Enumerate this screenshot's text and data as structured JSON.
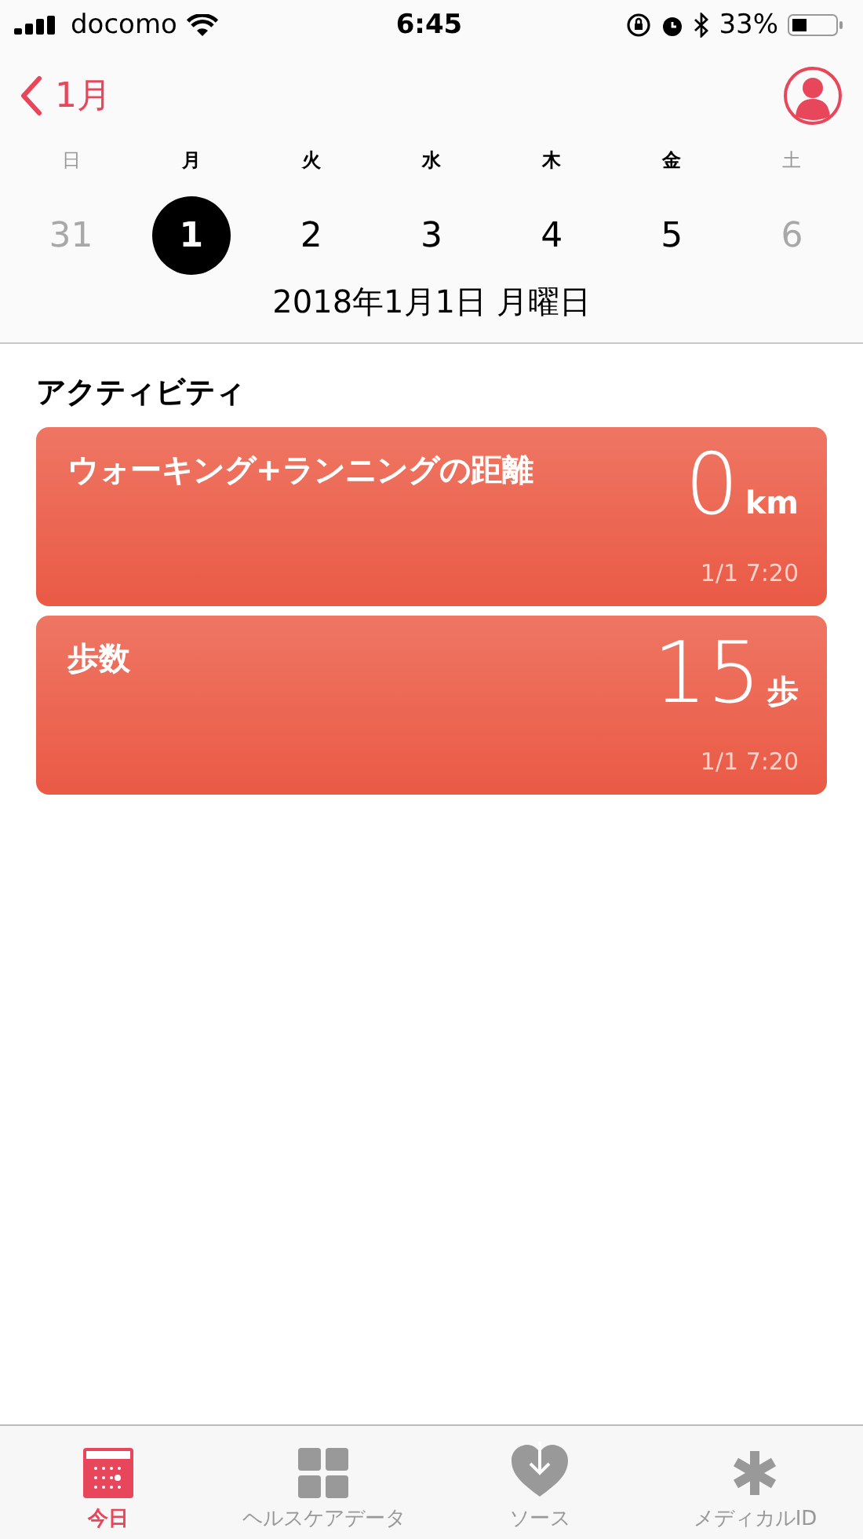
{
  "status_bar": {
    "carrier": "docomo",
    "time": "6:45",
    "battery": "33%"
  },
  "nav": {
    "back_label": "1月"
  },
  "weekdays": [
    {
      "label": "日",
      "dimmed": true
    },
    {
      "label": "月",
      "dimmed": false
    },
    {
      "label": "火",
      "dimmed": false
    },
    {
      "label": "水",
      "dimmed": false
    },
    {
      "label": "木",
      "dimmed": false
    },
    {
      "label": "金",
      "dimmed": false
    },
    {
      "label": "土",
      "dimmed": true
    }
  ],
  "days": [
    {
      "label": "31",
      "dimmed": true,
      "selected": false
    },
    {
      "label": "1",
      "dimmed": false,
      "selected": true
    },
    {
      "label": "2",
      "dimmed": false,
      "selected": false
    },
    {
      "label": "3",
      "dimmed": false,
      "selected": false
    },
    {
      "label": "4",
      "dimmed": false,
      "selected": false
    },
    {
      "label": "5",
      "dimmed": false,
      "selected": false
    },
    {
      "label": "6",
      "dimmed": true,
      "selected": false
    }
  ],
  "date_title": "2018年1月1日 月曜日",
  "section_title": "アクティビティ",
  "cards": [
    {
      "title": "ウォーキング+ランニングの距離",
      "value": "0",
      "unit": "km",
      "time": "1/1 7:20"
    },
    {
      "title": "歩数",
      "value": "15",
      "unit": "歩",
      "time": "1/1 7:20"
    }
  ],
  "tabs": [
    {
      "kind": "today",
      "label": "今日",
      "selected": true
    },
    {
      "kind": "data",
      "label": "ヘルスケアデータ",
      "selected": false
    },
    {
      "kind": "sources",
      "label": "ソース",
      "selected": false
    },
    {
      "kind": "medical",
      "label": "メディカルID",
      "selected": false
    }
  ]
}
